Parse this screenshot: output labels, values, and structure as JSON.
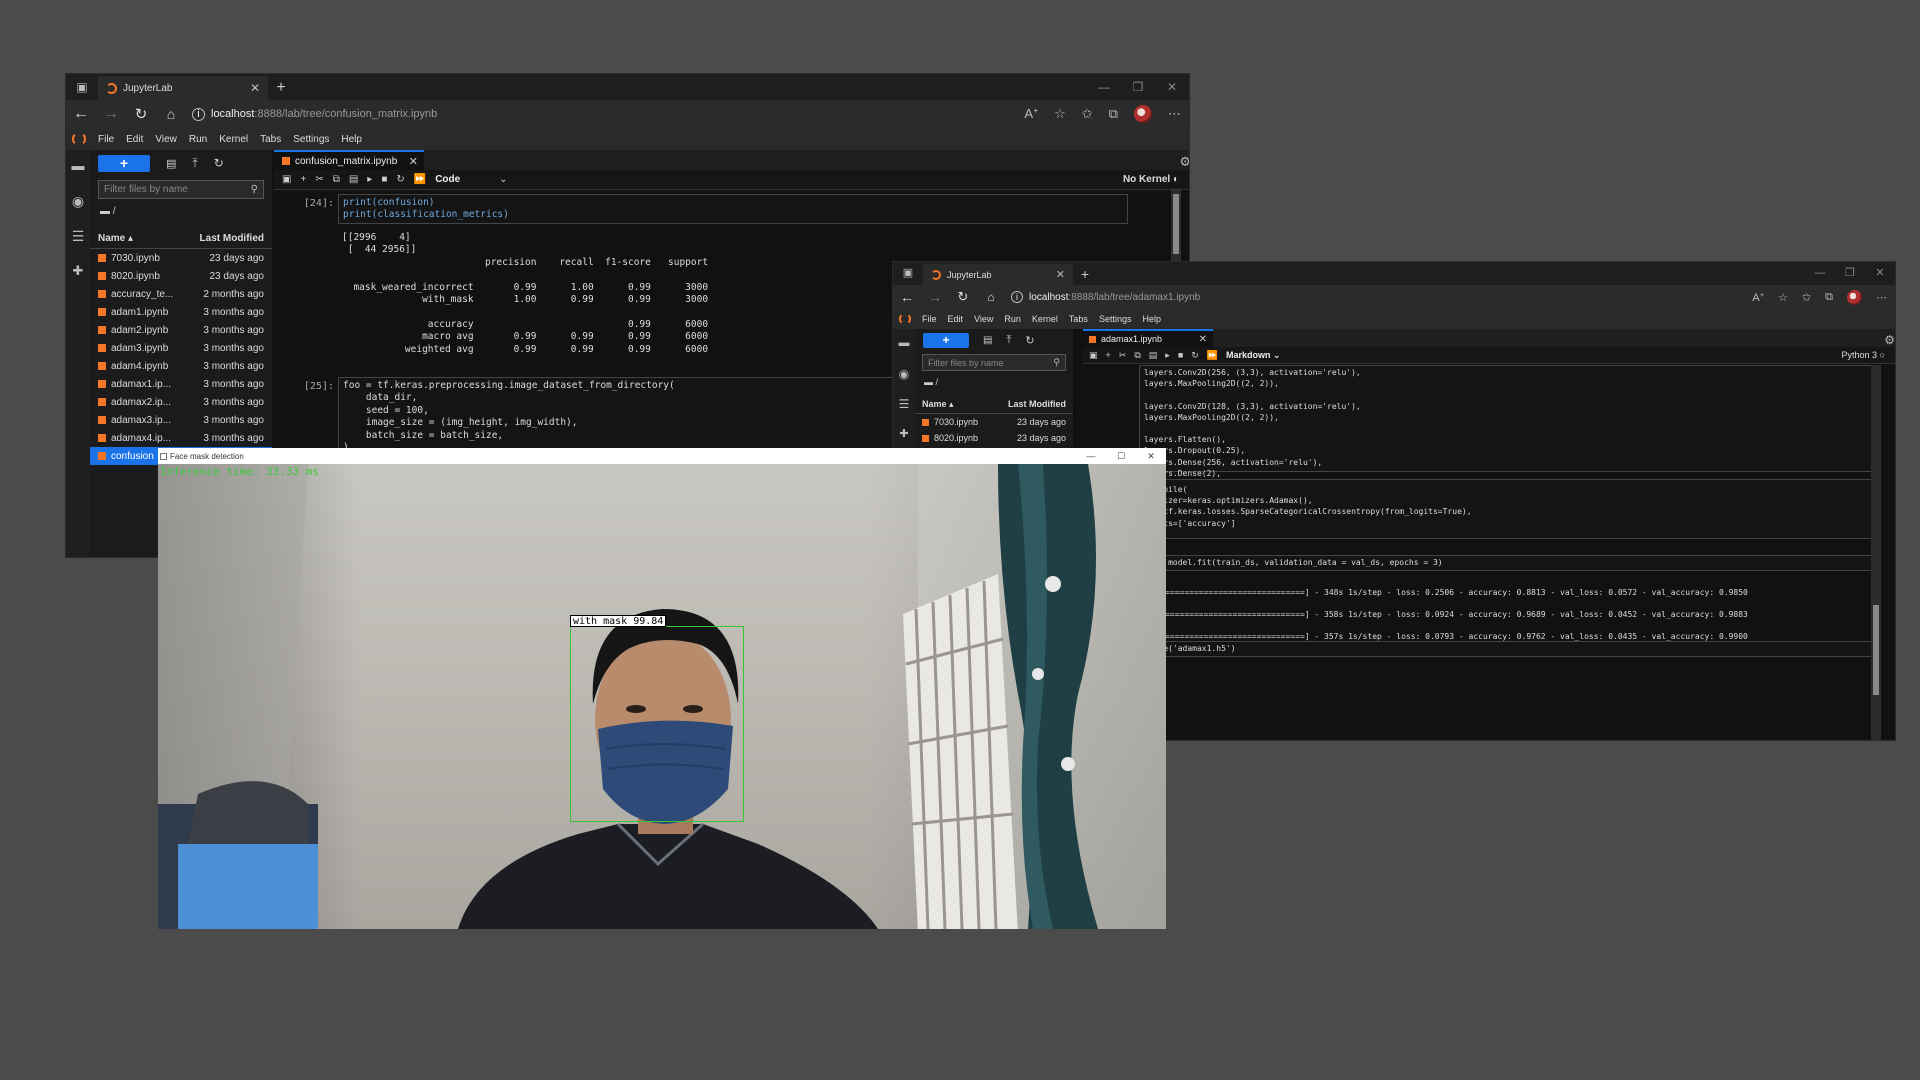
{
  "win1": {
    "tab_title": "JupyterLab",
    "url_host": "localhost",
    "url_path": ":8888/lab/tree/confusion_matrix.ipynb",
    "menu": [
      "File",
      "Edit",
      "View",
      "Run",
      "Kernel",
      "Tabs",
      "Settings",
      "Help"
    ],
    "filter_placeholder": "Filter files by name",
    "crumb": "/",
    "col_name": "Name",
    "col_modified": "Last Modified",
    "files": [
      {
        "name": "7030.ipynb",
        "modified": "23 days ago"
      },
      {
        "name": "8020.ipynb",
        "modified": "23 days ago"
      },
      {
        "name": "accuracy_te...",
        "modified": "2 months ago"
      },
      {
        "name": "adam1.ipynb",
        "modified": "3 months ago"
      },
      {
        "name": "adam2.ipynb",
        "modified": "3 months ago"
      },
      {
        "name": "adam3.ipynb",
        "modified": "3 months ago"
      },
      {
        "name": "adam4.ipynb",
        "modified": "3 months ago"
      },
      {
        "name": "adamax1.ip...",
        "modified": "3 months ago"
      },
      {
        "name": "adamax2.ip...",
        "modified": "3 months ago"
      },
      {
        "name": "adamax3.ip...",
        "modified": "3 months ago"
      },
      {
        "name": "adamax4.ip...",
        "modified": "3 months ago"
      },
      {
        "name": "confusion",
        "modified": ""
      }
    ],
    "doc_tab": "confusion_matrix.ipynb",
    "cell_type": "Code",
    "kernel": "No Kernel",
    "cell24_prompt": "[24]:",
    "cell24_code": [
      "print(confusion)",
      "print(classification_metrics)"
    ],
    "cell24_output": "[[2996    4]\n [  44 2956]]\n                         precision    recall  f1-score   support\n\n  mask_weared_incorrect       0.99      1.00      0.99      3000\n              with_mask       1.00      0.99      0.99      3000\n\n               accuracy                           0.99      6000\n              macro avg       0.99      0.99      0.99      6000\n           weighted avg       0.99      0.99      0.99      6000",
    "cell25_prompt": "[25]:",
    "cell25_code": "foo = tf.keras.preprocessing.image_dataset_from_directory(\n    data_dir,\n    seed = 100,\n    image_size = (img_height, img_width),\n    batch_size = batch_size,\n)"
  },
  "win2": {
    "tab_title": "JupyterLab",
    "url_host": "localhost",
    "url_path": ":8888/lab/tree/adamax1.ipynb",
    "menu": [
      "File",
      "Edit",
      "View",
      "Run",
      "Kernel",
      "Tabs",
      "Settings",
      "Help"
    ],
    "filter_placeholder": "Filter files by name",
    "crumb": "/",
    "col_name": "Name",
    "col_modified": "Last Modified",
    "files": [
      {
        "name": "7030.ipynb",
        "modified": "23 days ago"
      },
      {
        "name": "8020.ipynb",
        "modified": "23 days ago"
      }
    ],
    "doc_tab": "adamax1.ipynb",
    "cell_type": "Markdown",
    "kernel": "Python 3",
    "code_a": "layers.Conv2D(256, (3,3), activation='relu'),\nlayers.MaxPooling2D((2, 2)),\n\nlayers.Conv2D(128, (3,3), activation='relu'),\nlayers.MaxPooling2D((2, 2)),\n\nlayers.Flatten(),\nlayers.Dropout(0.25),\nlayers.Dense(256, activation='relu'),\nlayers.Dense(2),",
    "code_b": ".compile(\nptimizer=keras.optimizers.Adamax(),\noss=tf.keras.losses.SparseCategoricalCrossentropy(from_logits=True),\netrics=['accuracy']",
    "code_c": "ry = model.fit(train_ds, validation_data = val_ds, epochs = 3)",
    "train_output": " 1/3\n40 [==============================] - 348s 1s/step - loss: 0.2506 - accuracy: 0.8813 - val_loss: 0.0572 - val_accuracy: 0.9850\n 2/3\n40 [==============================] - 358s 1s/step - loss: 0.0924 - accuracy: 0.9689 - val_loss: 0.0452 - val_accuracy: 0.9883\n 3/3\n40 [==============================] - 357s 1s/step - loss: 0.0793 - accuracy: 0.9762 - val_loss: 0.0435 - val_accuracy: 0.9900",
    "code_d": ".save('adamax1.h5')"
  },
  "cam": {
    "title": "Face mask detection",
    "fps_text": "Inference time: 33.33 ms",
    "label": "with_mask 99.84",
    "colors": {
      "box": "#35c835",
      "fps": "#3ec93e"
    }
  },
  "colors": {
    "accent": "#1a73e8",
    "notebook": "#f37726",
    "background": "#4b4b4b"
  }
}
